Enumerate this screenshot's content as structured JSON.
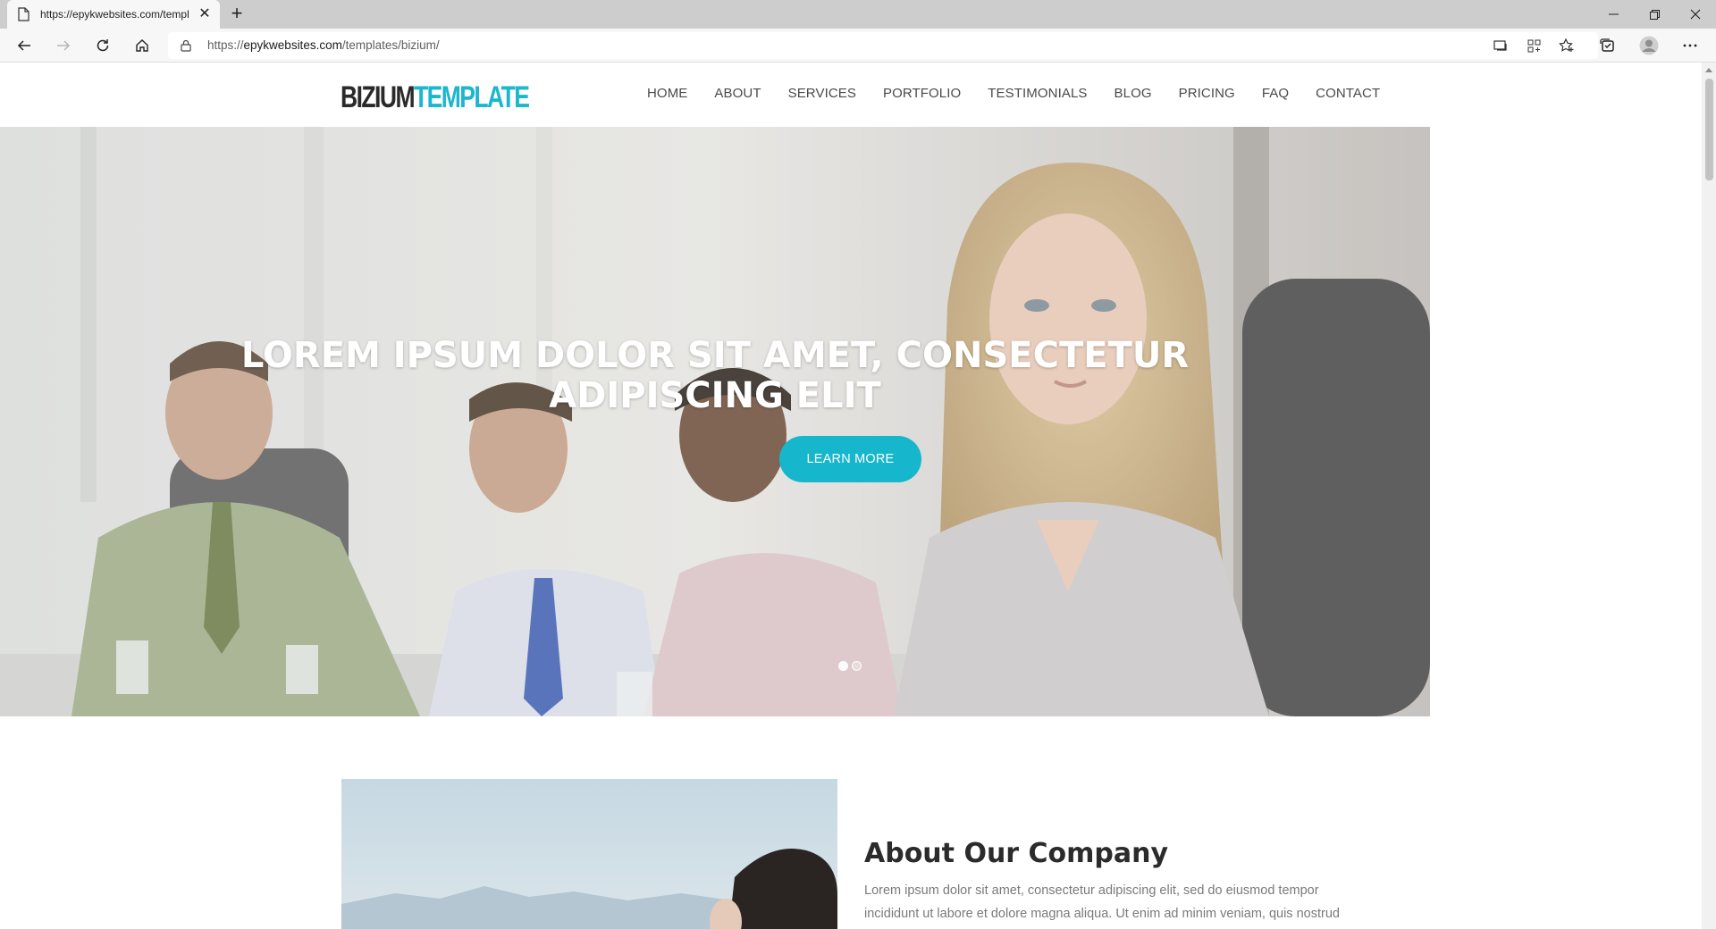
{
  "browser": {
    "tab_title": "https://epykwebsites.com/templ",
    "address_prefix": "https://",
    "address_host": "epykwebsites.com",
    "address_path": "/templates/bizium/"
  },
  "site": {
    "logo_part1": "BIZIUM",
    "logo_part2": "TEMPLATE",
    "nav": [
      "HOME",
      "ABOUT",
      "SERVICES",
      "PORTFOLIO",
      "TESTIMONIALS",
      "BLOG",
      "PRICING",
      "FAQ",
      "CONTACT"
    ],
    "hero": {
      "title_line1": "LOREM IPSUM DOLOR SIT AMET, CONSECTETUR",
      "title_line2": "ADIPISCING ELIT",
      "button": "LEARN MORE",
      "slide_count": 2,
      "active_slide": 1
    },
    "about": {
      "title": "About Our Company",
      "text_line1": "Lorem ipsum dolor sit amet, consectetur adipiscing elit, sed do eiusmod tempor",
      "text_line2": "incididunt ut labore et dolore magna aliqua. Ut enim ad minim veniam, quis nostrud"
    }
  },
  "colors": {
    "accent": "#16b6cc",
    "logo_dark": "#2a2a2a",
    "nav_text": "#4a4a4a"
  }
}
